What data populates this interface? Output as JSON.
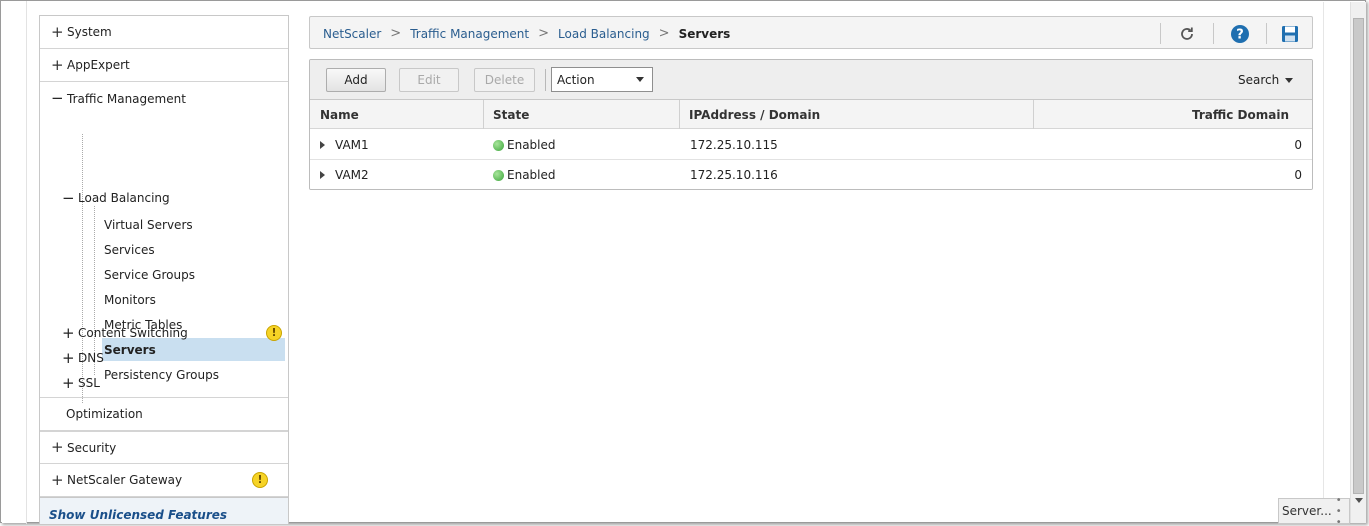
{
  "sidebar": {
    "system": "System",
    "appexpert": "AppExpert",
    "traffic_management": "Traffic Management",
    "load_balancing": "Load Balancing",
    "lb_items": [
      "Virtual Servers",
      "Services",
      "Service Groups",
      "Monitors",
      "Metric Tables",
      "Servers",
      "Persistency Groups"
    ],
    "content_switching": "Content Switching",
    "dns": "DNS",
    "ssl": "SSL",
    "optimization": "Optimization",
    "security": "Security",
    "netscaler_gateway": "NetScaler Gateway",
    "show_unlicensed": "Show Unlicensed Features",
    "warning_glyph": "!"
  },
  "breadcrumb": {
    "items": [
      "NetScaler",
      "Traffic Management",
      "Load Balancing"
    ],
    "current": "Servers",
    "separator": ">"
  },
  "toolbar": {
    "add": "Add",
    "edit": "Edit",
    "delete": "Delete",
    "action": "Action",
    "search": "Search"
  },
  "table": {
    "columns": [
      "Name",
      "State",
      "IPAddress / Domain",
      "Traffic Domain"
    ],
    "rows": [
      {
        "name": "VAM1",
        "state": "Enabled",
        "ip": "172.25.10.115",
        "domain": "0"
      },
      {
        "name": "VAM2",
        "state": "Enabled",
        "ip": "172.25.10.116",
        "domain": "0"
      }
    ]
  },
  "status_tip": {
    "text": "Server...",
    "dots": "• • •"
  },
  "colors": {
    "link": "#2a5d8f",
    "selected_row": "#c9dff0",
    "enabled": "#3aa53a",
    "warning": "#f6d326"
  }
}
